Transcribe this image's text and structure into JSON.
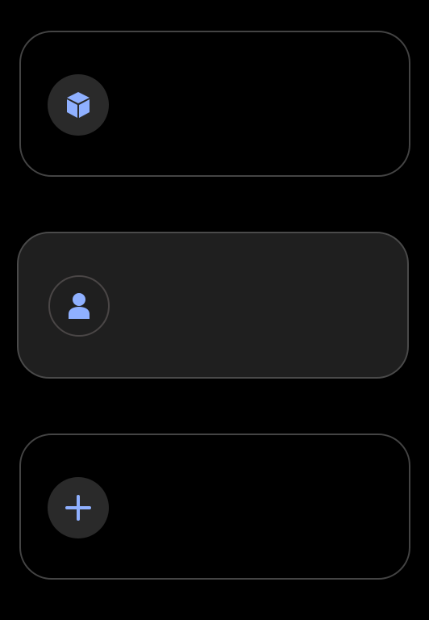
{
  "colors": {
    "background": "#000000",
    "accent": "#8fb0ff",
    "card_border": "#444444",
    "selected_card_bg": "#1f1f1f",
    "badge_bg": "#2a2a2a"
  },
  "items": [
    {
      "icon": "cube-icon",
      "selected": false
    },
    {
      "icon": "person-icon",
      "selected": true
    },
    {
      "icon": "plus-icon",
      "selected": false
    }
  ]
}
